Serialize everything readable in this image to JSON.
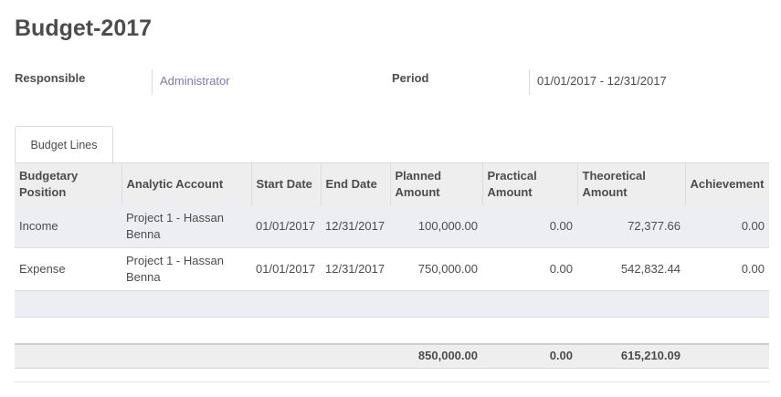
{
  "header": {
    "title": "Budget-2017"
  },
  "fields": {
    "responsible_label": "Responsible",
    "responsible_value": "Administrator",
    "period_label": "Period",
    "period_value": "01/01/2017 - 12/31/2017"
  },
  "tabs": [
    {
      "label": "Budget Lines",
      "active": true
    }
  ],
  "table": {
    "columns": [
      "Budgetary Position",
      "Analytic Account",
      "Start Date",
      "End Date",
      "Planned Amount",
      "Practical Amount",
      "Theoretical Amount",
      "Achievement"
    ],
    "rows": [
      {
        "position": "Income",
        "account": "Project 1 - Hassan Benna",
        "start": "01/01/2017",
        "end": "12/31/2017",
        "planned": "100,000.00",
        "practical": "0.00",
        "theoretical": "72,377.66",
        "achievement": "0.00"
      },
      {
        "position": "Expense",
        "account": "Project 1 - Hassan Benna",
        "start": "01/01/2017",
        "end": "12/31/2017",
        "planned": "750,000.00",
        "practical": "0.00",
        "theoretical": "542,832.44",
        "achievement": "0.00"
      }
    ],
    "totals": {
      "planned": "850,000.00",
      "practical": "0.00",
      "theoretical": "615,210.09"
    }
  },
  "colors": {
    "link": "#7c7bad",
    "header_bg": "#eeeeee",
    "stripe_bg": "#eceef4"
  }
}
